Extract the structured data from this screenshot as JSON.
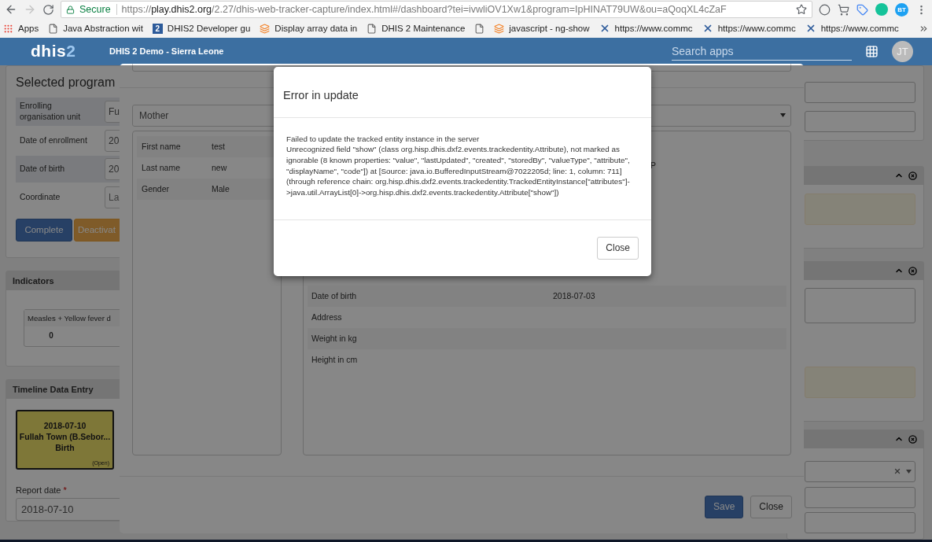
{
  "browser": {
    "back_enabled": true,
    "forward_enabled": false,
    "security_label": "Secure",
    "url_scheme": "https://",
    "url_host": "play.dhis2.org",
    "url_path": "/2.27/dhis-web-tracker-capture/index.html#/dashboard?tei=ivwliOV1Xw1&program=IpHINAT79UW&ou=aQoqXL4cZaF",
    "profile_badge": "BT"
  },
  "bookmarks": [
    {
      "kind": "apps",
      "label": "Apps"
    },
    {
      "kind": "page",
      "label": "Java Abstraction wit"
    },
    {
      "kind": "numbered",
      "badge": "2",
      "label": "DHIS2 Developer gu"
    },
    {
      "kind": "stack",
      "label": "Display array data in"
    },
    {
      "kind": "page",
      "label": "DHIS 2 Maintenance"
    },
    {
      "kind": "page"
    },
    {
      "kind": "stack",
      "label": "javascript - ng-show"
    },
    {
      "kind": "cross",
      "label": "https://www.commc"
    },
    {
      "kind": "cross",
      "label": "https://www.commc"
    },
    {
      "kind": "cross",
      "label": "https://www.commc"
    }
  ],
  "header": {
    "logo_main": "dhis",
    "logo_accent": "2",
    "title": "DHIS 2 Demo - Sierra Leone",
    "search_placeholder": "Search apps",
    "avatar": "JT"
  },
  "enrollment": {
    "title": "Selected program",
    "rows": [
      {
        "label": "Enrolling organisation unit",
        "value": "Fu"
      },
      {
        "label": "Date of enrollment",
        "value": "20"
      },
      {
        "label": "Date of birth",
        "value": "20"
      },
      {
        "label": "Coordinate",
        "placeholder": "La"
      }
    ],
    "buttons": [
      {
        "kind": "primary",
        "label": "Complete"
      },
      {
        "kind": "warning",
        "label": "Deactivat"
      }
    ]
  },
  "indicators": {
    "title": "Indicators",
    "items": [
      {
        "name": "Measles + Yellow fever d",
        "value": "0"
      }
    ]
  },
  "timeline": {
    "title": "Timeline Data Entry",
    "events": [
      {
        "date": "2018-07-10",
        "org_unit": "Fullah Town (B.Sebor...",
        "stage": "Birth",
        "status": "(Open)"
      }
    ],
    "report_date": {
      "label": "Report date",
      "required_mark": "*",
      "value": "2018-07-10"
    }
  },
  "dialog": {
    "relationship": "Mother",
    "profile": [
      {
        "label": "First name",
        "value": "test"
      },
      {
        "label": "Last name",
        "value": "new"
      },
      {
        "label": "Gender",
        "value": "Male"
      }
    ],
    "covered_value": "P",
    "attributes": [
      {
        "label": "Date of birth",
        "value": "2018-07-03"
      },
      {
        "label": "Address"
      },
      {
        "label": "Weight in kg"
      },
      {
        "label": "Height in cm"
      }
    ],
    "buttons": [
      {
        "kind": "primary",
        "label": "Save"
      },
      {
        "kind": "default",
        "label": "Close"
      }
    ]
  },
  "error_modal": {
    "title": "Error in update",
    "message": [
      "Failed to update the tracked entity instance in the server",
      "Unrecognized field \"show\" (class org.hisp.dhis.dxf2.events.trackedentity.Attribute), not marked as ignorable (8 known properties: \"value\", \"lastUpdated\", \"created\", \"storedBy\", \"valueType\", \"attribute\", \"displayName\", \"code\"]) at [Source: java.io.BufferedInputStream@7022205d; line: 1, column: 711] (through reference chain: org.hisp.dhis.dxf2.events.trackedentity.TrackedEntityInstance[\"attributes\"]->java.util.ArrayList[0]->org.hisp.dhis.dxf2.events.trackedentity.Attribute[\"show\"])"
    ],
    "button": "Close"
  }
}
